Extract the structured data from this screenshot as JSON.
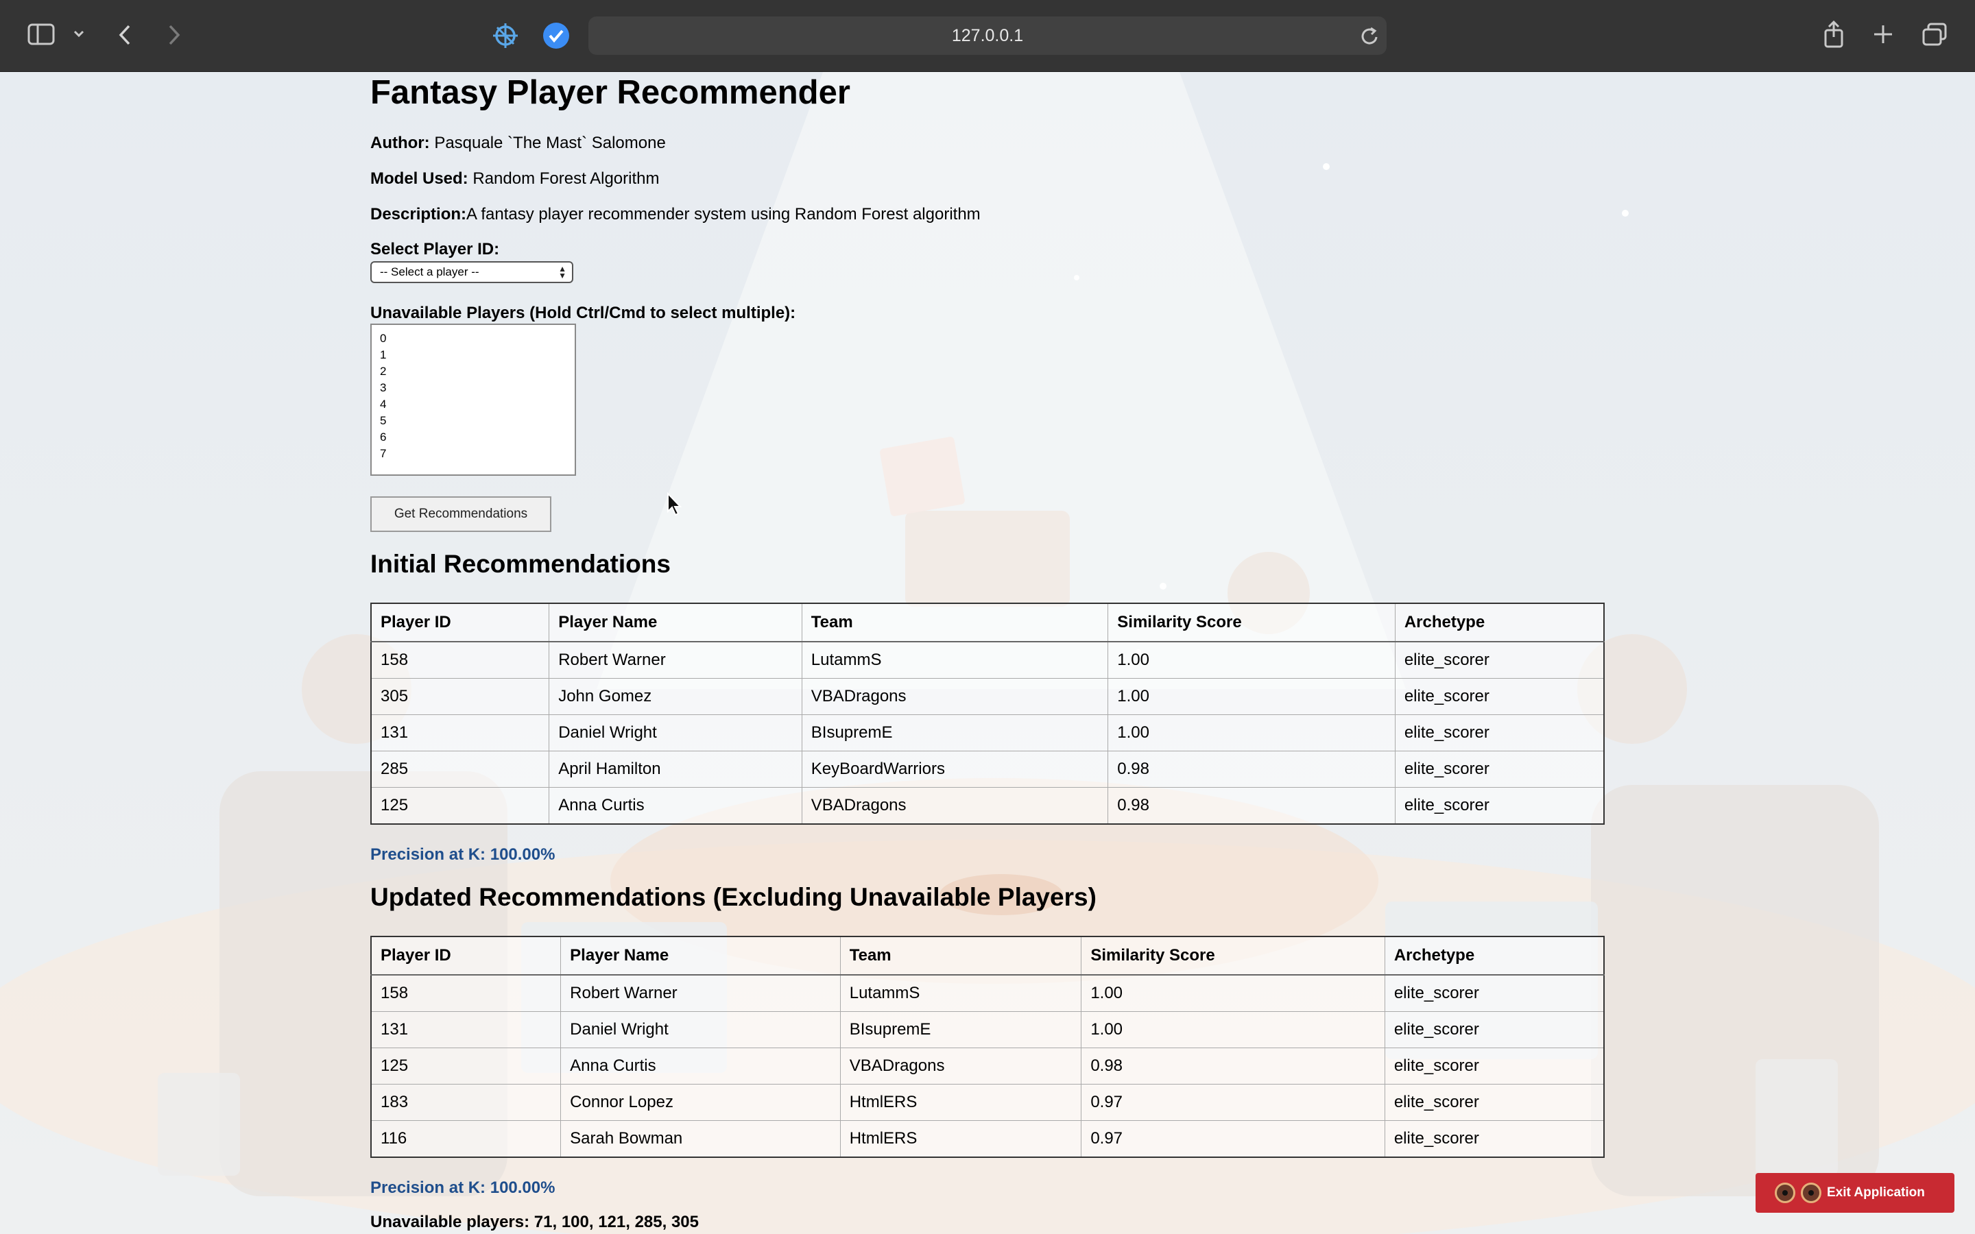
{
  "browser": {
    "url": "127.0.0.1"
  },
  "page": {
    "title": "Fantasy Player Recommender",
    "author_label": "Author:",
    "author_value": "Pasquale `The Mast` Salomone",
    "model_label": "Model Used:",
    "model_value": "Random Forest Algorithm",
    "description_label": "Description:",
    "description_value": "A fantasy player recommender system using Random Forest algorithm",
    "select_label": "Select Player ID:",
    "select_value": "-- Select a player --",
    "unavailable_label": "Unavailable Players (Hold Ctrl/Cmd to select multiple):",
    "unavailable_options": [
      "0",
      "1",
      "2",
      "3",
      "4",
      "5",
      "6",
      "7"
    ],
    "button_label": "Get Recommendations",
    "initial_heading": "Initial Recommendations",
    "updated_heading": "Updated Recommendations (Excluding Unavailable Players)",
    "columns": [
      "Player ID",
      "Player Name",
      "Team",
      "Similarity Score",
      "Archetype"
    ],
    "initial_rows": [
      [
        "158",
        "Robert Warner",
        "LutammS",
        "1.00",
        "elite_scorer"
      ],
      [
        "305",
        "John Gomez",
        "VBADragons",
        "1.00",
        "elite_scorer"
      ],
      [
        "131",
        "Daniel Wright",
        "BIsupremE",
        "1.00",
        "elite_scorer"
      ],
      [
        "285",
        "April Hamilton",
        "KeyBoardWarriors",
        "0.98",
        "elite_scorer"
      ],
      [
        "125",
        "Anna Curtis",
        "VBADragons",
        "0.98",
        "elite_scorer"
      ]
    ],
    "initial_precision": "Precision at K: 100.00%",
    "updated_rows": [
      [
        "158",
        "Robert Warner",
        "LutammS",
        "1.00",
        "elite_scorer"
      ],
      [
        "131",
        "Daniel Wright",
        "BIsupremE",
        "1.00",
        "elite_scorer"
      ],
      [
        "125",
        "Anna Curtis",
        "VBADragons",
        "0.98",
        "elite_scorer"
      ],
      [
        "183",
        "Connor Lopez",
        "HtmlERS",
        "0.97",
        "elite_scorer"
      ],
      [
        "116",
        "Sarah Bowman",
        "HtmlERS",
        "0.97",
        "elite_scorer"
      ]
    ],
    "updated_precision": "Precision at K: 100.00%",
    "unavailable_summary": "Unavailable players: 71, 100, 121, 285, 305"
  },
  "exit_button": {
    "label": "Exit Application"
  },
  "colors": {
    "toolbar": "#343434",
    "address_bar": "#414141",
    "precision_text": "#1f4e8c",
    "exit_button": "#c82a32"
  }
}
